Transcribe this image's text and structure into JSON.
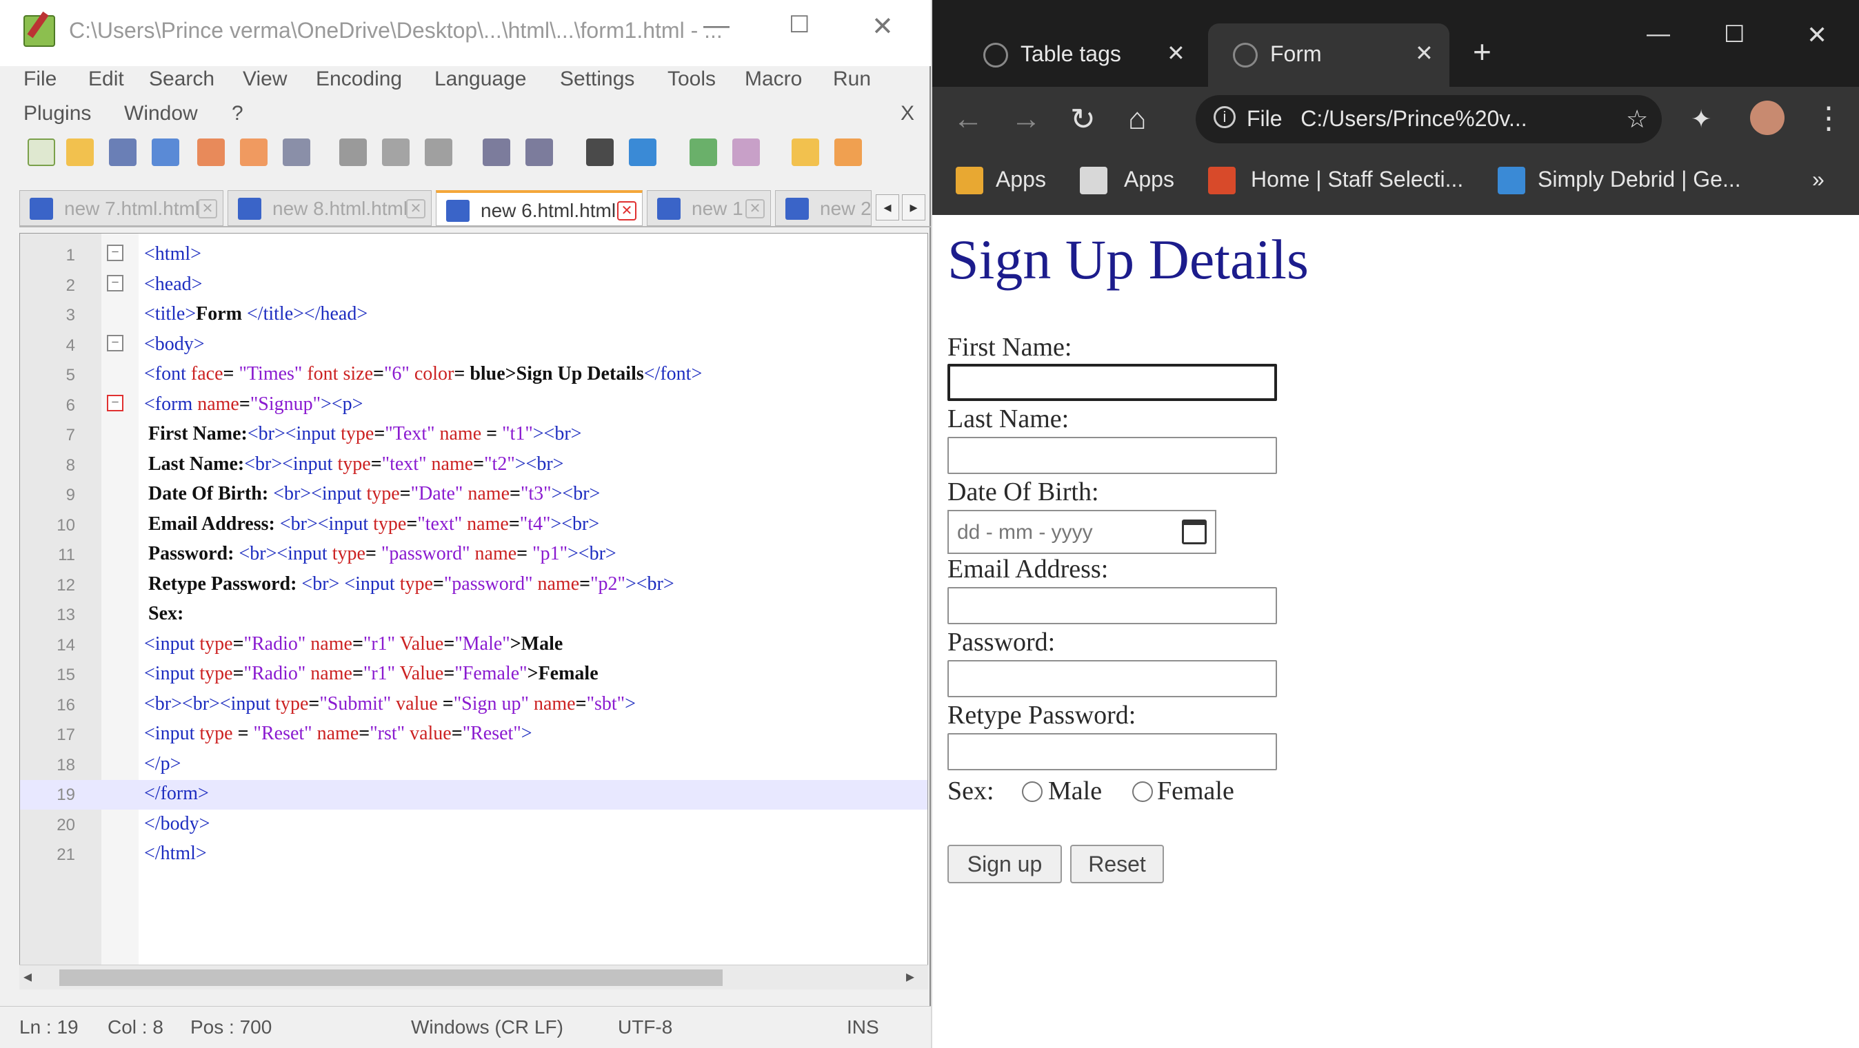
{
  "npp": {
    "title": "C:\\Users\\Prince verma\\OneDrive\\Desktop\\...\\html\\...\\form1.html - ...",
    "menu": [
      "File",
      "Edit",
      "Search",
      "View",
      "Encoding",
      "Language",
      "Settings",
      "Tools",
      "Macro",
      "Run",
      "Plugins",
      "Window",
      "?"
    ],
    "menu_close": "X",
    "tabs": [
      "new 7.html.html",
      "new 8.html.html",
      "new 6.html.html",
      "new 1",
      "new 2"
    ],
    "active_tab": 2,
    "code_lines": [
      {
        "n": "1",
        "parts": [
          {
            "c": "tg",
            "t": "<html>"
          }
        ]
      },
      {
        "n": "2",
        "parts": [
          {
            "c": "tg",
            "t": "<head>"
          }
        ]
      },
      {
        "n": "3",
        "parts": [
          {
            "c": "tg",
            "t": "<title>"
          },
          {
            "c": "tx",
            "t": "Form"
          },
          {
            "c": "tg",
            "t": " </title></head>"
          }
        ]
      },
      {
        "n": "4",
        "parts": [
          {
            "c": "tg",
            "t": "<body>"
          }
        ]
      },
      {
        "n": "5",
        "parts": [
          {
            "c": "tg",
            "t": "<font "
          },
          {
            "c": "at",
            "t": "face"
          },
          {
            "c": "tx",
            "t": "= "
          },
          {
            "c": "vl",
            "t": "\"Times\" "
          },
          {
            "c": "at",
            "t": "font size"
          },
          {
            "c": "tx",
            "t": "="
          },
          {
            "c": "vl",
            "t": "\"6\" "
          },
          {
            "c": "at",
            "t": "color"
          },
          {
            "c": "tx",
            "t": "= blue>Sign Up Details"
          },
          {
            "c": "tg",
            "t": "</font>"
          }
        ]
      },
      {
        "n": "6",
        "parts": [
          {
            "c": "tg",
            "t": "<form "
          },
          {
            "c": "at",
            "t": "name"
          },
          {
            "c": "tx",
            "t": "="
          },
          {
            "c": "vl",
            "t": "\"Signup\""
          },
          {
            "c": "tg",
            "t": "><p>"
          }
        ]
      },
      {
        "n": "7",
        "parts": [
          {
            "c": "tx",
            "t": "First Name:"
          },
          {
            "c": "tg",
            "t": "<br><input "
          },
          {
            "c": "at",
            "t": "type"
          },
          {
            "c": "tx",
            "t": "="
          },
          {
            "c": "vl",
            "t": "\"Text\" "
          },
          {
            "c": "at",
            "t": "name "
          },
          {
            "c": "tx",
            "t": "= "
          },
          {
            "c": "vl",
            "t": "\"t1\""
          },
          {
            "c": "tg",
            "t": "><br>"
          }
        ]
      },
      {
        "n": "8",
        "parts": [
          {
            "c": "tx",
            "t": "Last Name:"
          },
          {
            "c": "tg",
            "t": "<br><input "
          },
          {
            "c": "at",
            "t": "type"
          },
          {
            "c": "tx",
            "t": "="
          },
          {
            "c": "vl",
            "t": "\"text\" "
          },
          {
            "c": "at",
            "t": "name"
          },
          {
            "c": "tx",
            "t": "="
          },
          {
            "c": "vl",
            "t": "\"t2\""
          },
          {
            "c": "tg",
            "t": "><br>"
          }
        ]
      },
      {
        "n": "9",
        "parts": [
          {
            "c": "tx",
            "t": "Date Of Birth: "
          },
          {
            "c": "tg",
            "t": "<br><input "
          },
          {
            "c": "at",
            "t": "type"
          },
          {
            "c": "tx",
            "t": "="
          },
          {
            "c": "vl",
            "t": "\"Date\" "
          },
          {
            "c": "at",
            "t": "name"
          },
          {
            "c": "tx",
            "t": "="
          },
          {
            "c": "vl",
            "t": "\"t3\""
          },
          {
            "c": "tg",
            "t": "><br>"
          }
        ]
      },
      {
        "n": "10",
        "parts": [
          {
            "c": "tx",
            "t": "Email Address: "
          },
          {
            "c": "tg",
            "t": "<br><input "
          },
          {
            "c": "at",
            "t": "type"
          },
          {
            "c": "tx",
            "t": "="
          },
          {
            "c": "vl",
            "t": "\"text\" "
          },
          {
            "c": "at",
            "t": "name"
          },
          {
            "c": "tx",
            "t": "="
          },
          {
            "c": "vl",
            "t": "\"t4\""
          },
          {
            "c": "tg",
            "t": "><br>"
          }
        ]
      },
      {
        "n": "11",
        "parts": [
          {
            "c": "tx",
            "t": "Password: "
          },
          {
            "c": "tg",
            "t": "<br><input "
          },
          {
            "c": "at",
            "t": "type"
          },
          {
            "c": "tx",
            "t": "= "
          },
          {
            "c": "vl",
            "t": "\"password\" "
          },
          {
            "c": "at",
            "t": "name"
          },
          {
            "c": "tx",
            "t": "= "
          },
          {
            "c": "vl",
            "t": "\"p1\""
          },
          {
            "c": "tg",
            "t": "><br>"
          }
        ]
      },
      {
        "n": "12",
        "parts": [
          {
            "c": "tx",
            "t": "Retype Password: "
          },
          {
            "c": "tg",
            "t": "<br> <input "
          },
          {
            "c": "at",
            "t": "type"
          },
          {
            "c": "tx",
            "t": "="
          },
          {
            "c": "vl",
            "t": "\"password\" "
          },
          {
            "c": "at",
            "t": "name"
          },
          {
            "c": "tx",
            "t": "="
          },
          {
            "c": "vl",
            "t": "\"p2\""
          },
          {
            "c": "tg",
            "t": "><br>"
          }
        ]
      },
      {
        "n": "13",
        "parts": [
          {
            "c": "tx",
            "t": "Sex:"
          }
        ]
      },
      {
        "n": "14",
        "parts": [
          {
            "c": "tg",
            "t": "<input "
          },
          {
            "c": "at",
            "t": "type"
          },
          {
            "c": "tx",
            "t": "="
          },
          {
            "c": "vl",
            "t": "\"Radio\" "
          },
          {
            "c": "at",
            "t": "name"
          },
          {
            "c": "tx",
            "t": "="
          },
          {
            "c": "vl",
            "t": "\"r1\" "
          },
          {
            "c": "at",
            "t": "Value"
          },
          {
            "c": "tx",
            "t": "="
          },
          {
            "c": "vl",
            "t": "\"Male\""
          },
          {
            "c": "tx",
            "t": ">Male"
          }
        ]
      },
      {
        "n": "15",
        "parts": [
          {
            "c": "tg",
            "t": "<input "
          },
          {
            "c": "at",
            "t": "type"
          },
          {
            "c": "tx",
            "t": "="
          },
          {
            "c": "vl",
            "t": "\"Radio\" "
          },
          {
            "c": "at",
            "t": "name"
          },
          {
            "c": "tx",
            "t": "="
          },
          {
            "c": "vl",
            "t": "\"r1\" "
          },
          {
            "c": "at",
            "t": "Value"
          },
          {
            "c": "tx",
            "t": "="
          },
          {
            "c": "vl",
            "t": "\"Female\""
          },
          {
            "c": "tx",
            "t": ">Female"
          }
        ]
      },
      {
        "n": "16",
        "parts": [
          {
            "c": "tg",
            "t": "<br><br><input "
          },
          {
            "c": "at",
            "t": "type"
          },
          {
            "c": "tx",
            "t": "="
          },
          {
            "c": "vl",
            "t": "\"Submit\" "
          },
          {
            "c": "at",
            "t": "value "
          },
          {
            "c": "tx",
            "t": "="
          },
          {
            "c": "vl",
            "t": "\"Sign up\" "
          },
          {
            "c": "at",
            "t": "name"
          },
          {
            "c": "tx",
            "t": "="
          },
          {
            "c": "vl",
            "t": "\"sbt\""
          },
          {
            "c": "tg",
            "t": ">"
          }
        ]
      },
      {
        "n": "17",
        "parts": [
          {
            "c": "tg",
            "t": "<input "
          },
          {
            "c": "at",
            "t": "type "
          },
          {
            "c": "tx",
            "t": "= "
          },
          {
            "c": "vl",
            "t": "\"Reset\" "
          },
          {
            "c": "at",
            "t": "name"
          },
          {
            "c": "tx",
            "t": "="
          },
          {
            "c": "vl",
            "t": "\"rst\" "
          },
          {
            "c": "at",
            "t": "value"
          },
          {
            "c": "tx",
            "t": "="
          },
          {
            "c": "vl",
            "t": "\"Reset\""
          },
          {
            "c": "tg",
            "t": ">"
          }
        ]
      },
      {
        "n": "18",
        "parts": [
          {
            "c": "tg",
            "t": "</p>"
          }
        ]
      },
      {
        "n": "19",
        "parts": [
          {
            "c": "tg",
            "t": "</form>"
          }
        ]
      },
      {
        "n": "20",
        "parts": [
          {
            "c": "tg",
            "t": "</body>"
          }
        ]
      },
      {
        "n": "21",
        "parts": [
          {
            "c": "tg",
            "t": "</html>"
          }
        ]
      }
    ],
    "current_line": "19",
    "status": {
      "ln": "Ln : 19",
      "col": "Col : 8",
      "pos": "Pos : 700",
      "eol": "Windows (CR LF)",
      "encoding": "UTF-8",
      "mode": "INS"
    }
  },
  "chrome": {
    "tabs": [
      {
        "title": "Table tags",
        "active": false
      },
      {
        "title": "Form",
        "active": true
      }
    ],
    "new_tab": "+",
    "url_scheme": "File",
    "url": "C:/Users/Prince%20v...",
    "bookmarks": [
      "Apps",
      "Apps",
      "Home | Staff Selecti...",
      "Simply Debrid | Ge..."
    ],
    "bookmarks_more": "»"
  },
  "form": {
    "heading": "Sign Up Details",
    "heading_color": "#1c1c8c",
    "first_name_label": "First Name:",
    "last_name_label": "Last Name:",
    "dob_label": "Date Of Birth:",
    "dob_placeholder": "dd - mm - yyyy",
    "email_label": "Email Address:",
    "password_label": "Password:",
    "retype_label": "Retype Password:",
    "sex_label": "Sex:",
    "male": "Male",
    "female": "Female",
    "signup_button": "Sign up",
    "reset_button": "Reset"
  },
  "colors": {
    "npp_tab_accent": "#f4a73a",
    "chrome_frame": "#1e1e1e",
    "chrome_toolbar": "#353535"
  }
}
